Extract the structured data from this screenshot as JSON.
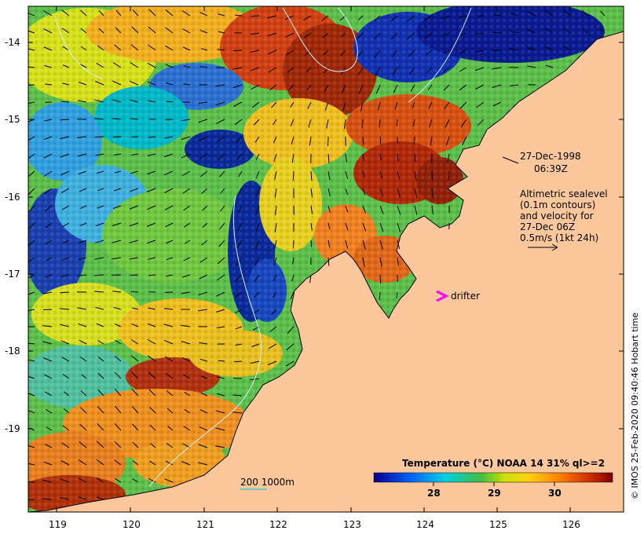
{
  "map": {
    "lat_ticks": [
      "-14",
      "-15",
      "-16",
      "-17",
      "-18",
      "-19"
    ],
    "lon_ticks": [
      "119",
      "120",
      "121",
      "122",
      "123",
      "124",
      "125",
      "126"
    ],
    "date_label": "27-Dec-1998",
    "time_label": "06:39Z",
    "altimetry_lines": [
      "Altimetric sealevel",
      "(0.1m contours)",
      "and velocity for",
      "27-Dec 06Z",
      "0.5m/s (1kt 24h)"
    ],
    "drifter_label": "drifter",
    "depth_label": "200  1000m",
    "colorbar_title": "Temperature (°C) NOAA 14 31% ql>=2",
    "colorbar_ticks": [
      "28",
      "29",
      "30"
    ],
    "credit": "© IMOS 25-Feb-2020 09:40:46 Hobart time",
    "colors": {
      "land": "#fbc79b",
      "drifter": "#ff00ff",
      "contour": "#d0f0ff",
      "depth": "#40c8c8"
    }
  }
}
